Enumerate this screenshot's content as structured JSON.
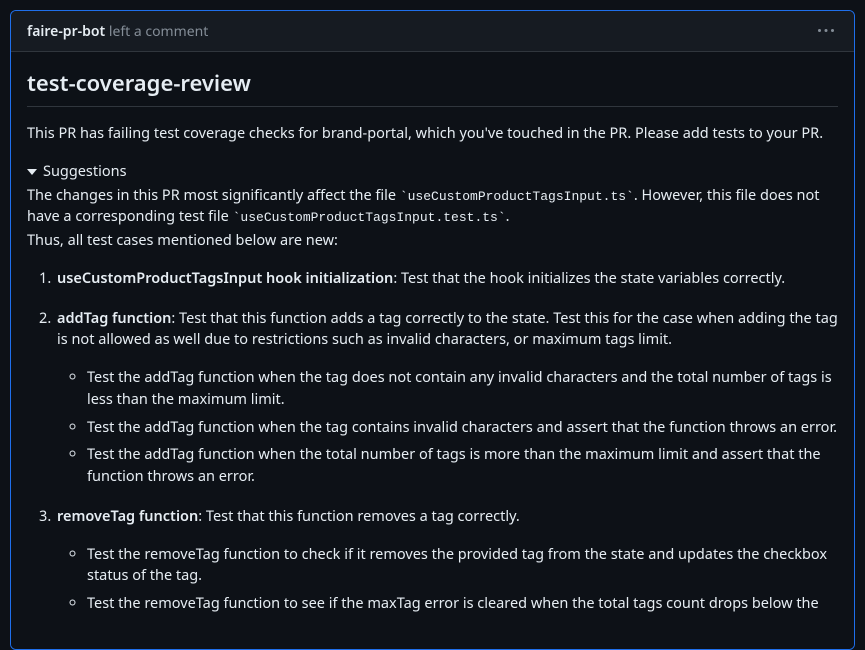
{
  "header": {
    "author": "faire-pr-bot",
    "action_text": " left a comment"
  },
  "body": {
    "title": "test-coverage-review",
    "intro": "This PR has failing test coverage checks for brand-portal, which you've touched in the PR. Please add tests to your PR.",
    "suggestions_label": "Suggestions",
    "para1_pre": "The changes in this PR most significantly affect the file ",
    "para1_code1": "`useCustomProductTagsInput.ts`",
    "para1_mid": ". However, this file does not have a corresponding test file ",
    "para1_code2": "`useCustomProductTagsInput.test.ts`",
    "para1_post": ".",
    "para2": "Thus, all test cases mentioned below are new:",
    "items": [
      {
        "title": "useCustomProductTagsInput hook initialization",
        "desc": ": Test that the hook initializes the state variables correctly.",
        "subs": []
      },
      {
        "title": "addTag function",
        "desc": ": Test that this function adds a tag correctly to the state. Test this for the case when adding the tag is not allowed as well due to restrictions such as invalid characters, or maximum tags limit.",
        "subs": [
          "Test the addTag function when the tag does not contain any invalid characters and the total number of tags is less than the maximum limit.",
          "Test the addTag function when the tag contains invalid characters and assert that the function throws an error.",
          "Test the addTag function when the total number of tags is more than the maximum limit and assert that the function throws an error."
        ]
      },
      {
        "title": "removeTag function",
        "desc": ": Test that this function removes a tag correctly.",
        "subs": [
          "Test the removeTag function to check if it removes the provided tag from the state and updates the checkbox status of the tag.",
          "Test the removeTag function to see if the maxTag error is cleared when the total tags count drops below the"
        ]
      }
    ]
  }
}
